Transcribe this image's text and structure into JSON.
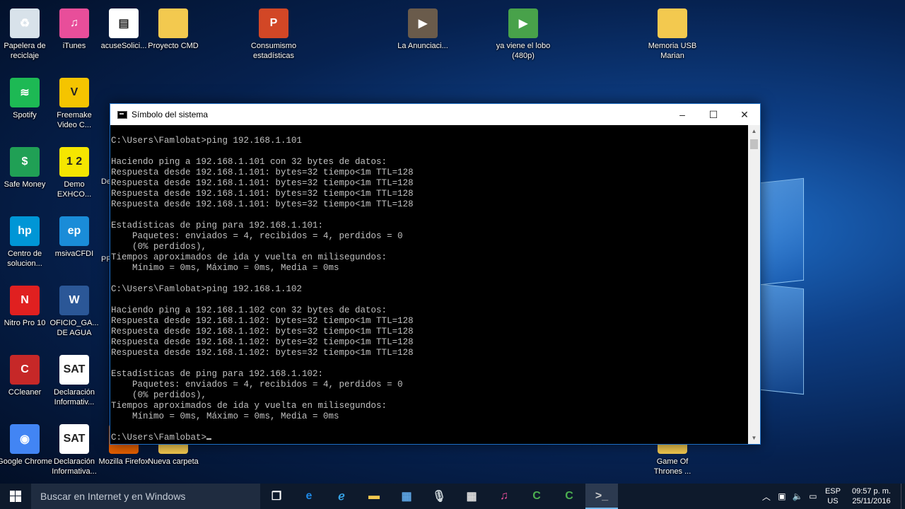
{
  "desktop": {
    "icons": [
      {
        "label": "Papelera de reciclaje",
        "icon": "recycle-bin-icon",
        "color": "#d8e2ea"
      },
      {
        "label": "iTunes",
        "icon": "itunes-icon",
        "color": "#e84e9a"
      },
      {
        "label": "acuseSolici...",
        "icon": "pdf-document-icon",
        "color": "#ffffff"
      },
      {
        "label": "Proyecto CMD",
        "icon": "folder-icon",
        "color": "#f3c94f"
      },
      {
        "label": "Consumismo estadísticas",
        "icon": "powerpoint-icon",
        "color": "#d24726"
      },
      {
        "label": "La Anunciaci...",
        "icon": "video-icon",
        "color": "#6a5b4b"
      },
      {
        "label": "ya viene el lobo (480p)",
        "icon": "video-icon",
        "color": "#48a24a"
      },
      {
        "label": "Memoria USB Marian",
        "icon": "folder-icon",
        "color": "#f3c94f"
      },
      {
        "label": "Spotify",
        "icon": "spotify-icon",
        "color": "#1db954"
      },
      {
        "label": "Freemake Video C...",
        "icon": "freemake-icon",
        "color": "#f5c400"
      },
      {
        "label": "Safe Money",
        "icon": "safe-money-icon",
        "color": "#20a055"
      },
      {
        "label": "Demo EXHCO...",
        "icon": "demo-icon",
        "color": "#f5e600"
      },
      {
        "label": "Centro de solucion...",
        "icon": "hp-icon",
        "color": "#0096d6"
      },
      {
        "label": "msivaCFDI",
        "icon": "cfdi-icon",
        "color": "#1a8cd8"
      },
      {
        "label": "Nitro Pro 10",
        "icon": "nitro-icon",
        "color": "#e02020"
      },
      {
        "label": "OFICIO_GA... DE AGUA",
        "icon": "word-icon",
        "color": "#2b5797"
      },
      {
        "label": "CCleaner",
        "icon": "ccleaner-icon",
        "color": "#c62828"
      },
      {
        "label": "Declaración Informativ...",
        "icon": "sat-icon",
        "color": "#ffffff"
      },
      {
        "label": "Google Chrome",
        "icon": "chrome-icon",
        "color": "#4285f4"
      },
      {
        "label": "Declaración Informativa...",
        "icon": "sat-icon",
        "color": "#ffffff"
      },
      {
        "label": "Mozilla Firefox",
        "icon": "firefox-icon",
        "color": "#e66000"
      },
      {
        "label": "Nueva carpeta",
        "icon": "folder-icon",
        "color": "#f3c94f"
      },
      {
        "label": "Game Of Thrones ...",
        "icon": "folder-icon",
        "color": "#f3c94f"
      }
    ],
    "partial_labels": [
      "De - A",
      "PR"
    ]
  },
  "window": {
    "title": "Símbolo del sistema",
    "minimize": "–",
    "maximize": "☐",
    "close": "✕",
    "console_text": "C:\\Users\\Famlobat>ping 192.168.1.101\n\nHaciendo ping a 192.168.1.101 con 32 bytes de datos:\nRespuesta desde 192.168.1.101: bytes=32 tiempo<1m TTL=128\nRespuesta desde 192.168.1.101: bytes=32 tiempo<1m TTL=128\nRespuesta desde 192.168.1.101: bytes=32 tiempo<1m TTL=128\nRespuesta desde 192.168.1.101: bytes=32 tiempo<1m TTL=128\n\nEstadísticas de ping para 192.168.1.101:\n    Paquetes: enviados = 4, recibidos = 4, perdidos = 0\n    (0% perdidos),\nTiempos aproximados de ida y vuelta en milisegundos:\n    Mínimo = 0ms, Máximo = 0ms, Media = 0ms\n\nC:\\Users\\Famlobat>ping 192.168.1.102\n\nHaciendo ping a 192.168.1.102 con 32 bytes de datos:\nRespuesta desde 192.168.1.102: bytes=32 tiempo<1m TTL=128\nRespuesta desde 192.168.1.102: bytes=32 tiempo<1m TTL=128\nRespuesta desde 192.168.1.102: bytes=32 tiempo<1m TTL=128\nRespuesta desde 192.168.1.102: bytes=32 tiempo<1m TTL=128\n\nEstadísticas de ping para 192.168.1.102:\n    Paquetes: enviados = 4, recibidos = 4, perdidos = 0\n    (0% perdidos),\nTiempos aproximados de ida y vuelta en milisegundos:\n    Mínimo = 0ms, Máximo = 0ms, Media = 0ms\n\n",
    "prompt": "C:\\Users\\Famlobat>"
  },
  "taskbar": {
    "search_placeholder": "Buscar en Internet y en Windows",
    "apps": [
      {
        "icon": "task-view-icon",
        "color": "#ffffff"
      },
      {
        "icon": "edge-icon",
        "color": "#1e88e5"
      },
      {
        "icon": "internet-explorer-icon",
        "color": "#36a3e6"
      },
      {
        "icon": "file-explorer-icon",
        "color": "#f3c94f"
      },
      {
        "icon": "store-icon",
        "color": "#5fa8e8"
      },
      {
        "icon": "microphone-icon",
        "color": "#cfd8dc"
      },
      {
        "icon": "calculator-icon",
        "color": "#e0e0e0"
      },
      {
        "icon": "itunes-icon",
        "color": "#e84e9a"
      },
      {
        "icon": "camtasia-icon",
        "color": "#4caf50"
      },
      {
        "icon": "camtasia-recorder-icon",
        "color": "#4caf50"
      },
      {
        "icon": "command-prompt-icon",
        "color": "#cccccc"
      }
    ],
    "active_app": "command-prompt-icon",
    "lang_top": "ESP",
    "lang_bottom": "US",
    "time": "09:57 p. m.",
    "date": "25/11/2016"
  }
}
